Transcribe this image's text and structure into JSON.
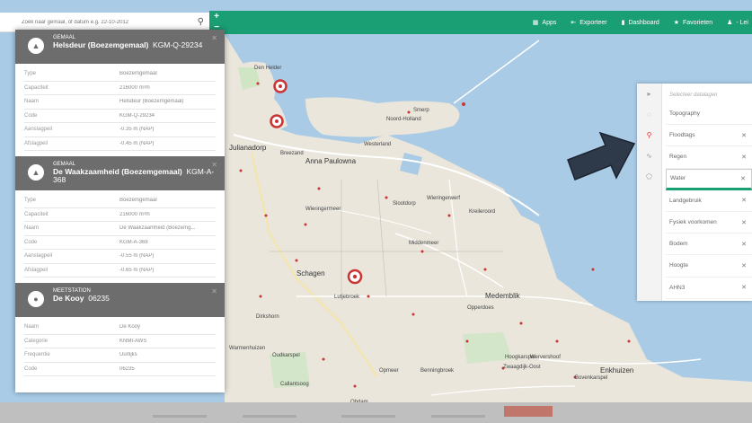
{
  "search": {
    "placeholder": "Zoek naar gemaal, of datum e.g. 22-10-2012"
  },
  "topnav": [
    {
      "icon": "grid-icon",
      "glyph": "▦",
      "label": "Apps"
    },
    {
      "icon": "export-icon",
      "glyph": "⇤",
      "label": "Exporteer"
    },
    {
      "icon": "dashboard-icon",
      "glyph": "▮",
      "label": "Dashboard"
    },
    {
      "icon": "star-icon",
      "glyph": "★",
      "label": "Favorieten"
    },
    {
      "icon": "user-icon",
      "glyph": "♟",
      "label": "- Lei"
    }
  ],
  "zoom": {
    "in": "+",
    "out": "−"
  },
  "info": {
    "sections": [
      {
        "category": "GEMAAL",
        "title": "Helsdeur (Boezemgemaal)",
        "code": "KGM-Q-29234",
        "rows": [
          {
            "k": "Type",
            "v": "Boezemgemaal"
          },
          {
            "k": "Capaciteit",
            "v": "216000 m³/h"
          },
          {
            "k": "Naam",
            "v": "Helsdeur (Boezemgemaal)"
          },
          {
            "k": "Code",
            "v": "KGM-Q-29234"
          },
          {
            "k": "Aanslagpeil",
            "v": "-0.35 m (NAP)"
          },
          {
            "k": "Afslagpeil",
            "v": "-0.45 m (NAP)"
          }
        ]
      },
      {
        "category": "GEMAAL",
        "title": "De Waakzaamheid (Boezemgemaal)",
        "code": "KGM-A-368",
        "rows": [
          {
            "k": "Type",
            "v": "Boezemgemaal"
          },
          {
            "k": "Capaciteit",
            "v": "216000 m³/h"
          },
          {
            "k": "Naam",
            "v": "De Waakzaamheid (Boezemg..."
          },
          {
            "k": "Code",
            "v": "KGM-A-368"
          },
          {
            "k": "Aanslagpeil",
            "v": "-0.55 m (NAP)"
          },
          {
            "k": "Afslagpeil",
            "v": "-0.65 m (NAP)"
          }
        ]
      },
      {
        "category": "MEETSTATION",
        "title": "De Kooy",
        "code": "06235",
        "rows": [
          {
            "k": "Naam",
            "v": "De Kooy"
          },
          {
            "k": "Categorie",
            "v": "KNMI-AWS"
          },
          {
            "k": "Frequentie",
            "v": "Uurlijks"
          },
          {
            "k": "Code",
            "v": "06235"
          }
        ]
      }
    ]
  },
  "layers": {
    "header": "Selecteer datalagen",
    "items": [
      {
        "label": "Topography",
        "removable": false,
        "selected": false
      },
      {
        "label": "Floodtags",
        "removable": true,
        "selected": false
      },
      {
        "label": "Regen",
        "removable": true,
        "selected": false
      },
      {
        "label": "Water",
        "removable": true,
        "selected": true
      },
      {
        "label": "Landgebruik",
        "removable": true,
        "selected": false
      },
      {
        "label": "Fysiek voorkomen",
        "removable": true,
        "selected": false
      },
      {
        "label": "Bodem",
        "removable": true,
        "selected": false
      },
      {
        "label": "Hoogte",
        "removable": true,
        "selected": false
      },
      {
        "label": "AHN3",
        "removable": true,
        "selected": false
      }
    ]
  },
  "map_labels": [
    "Den Helder",
    "Julianadorp",
    "Breezand",
    "Anna Paulowna",
    "Schagen",
    "Smerp",
    "Noord-Holland",
    "Westerland",
    "Slootdorp",
    "Wieringerwerf",
    "Kreileroord",
    "Middenmeer",
    "Medemblik",
    "Opperdoes",
    "Enkhuizen",
    "Wervershoof",
    "Hoogkarspel",
    "Bovenkarspel",
    "Zwaagdijk-Oost",
    "Dirkshorn",
    "Warmenhuizen",
    "Oudkarspel",
    "Obdam",
    "Benningbroek",
    "Opmeer",
    "Wieringermeer",
    "Callantsoog",
    "Lutjebroek"
  ],
  "colors": {
    "brand": "#1a9e73",
    "sea": "#a9cbe6",
    "land": "#eae6dc",
    "header_grey": "#6d6d6d",
    "marker": "#cc3333"
  }
}
